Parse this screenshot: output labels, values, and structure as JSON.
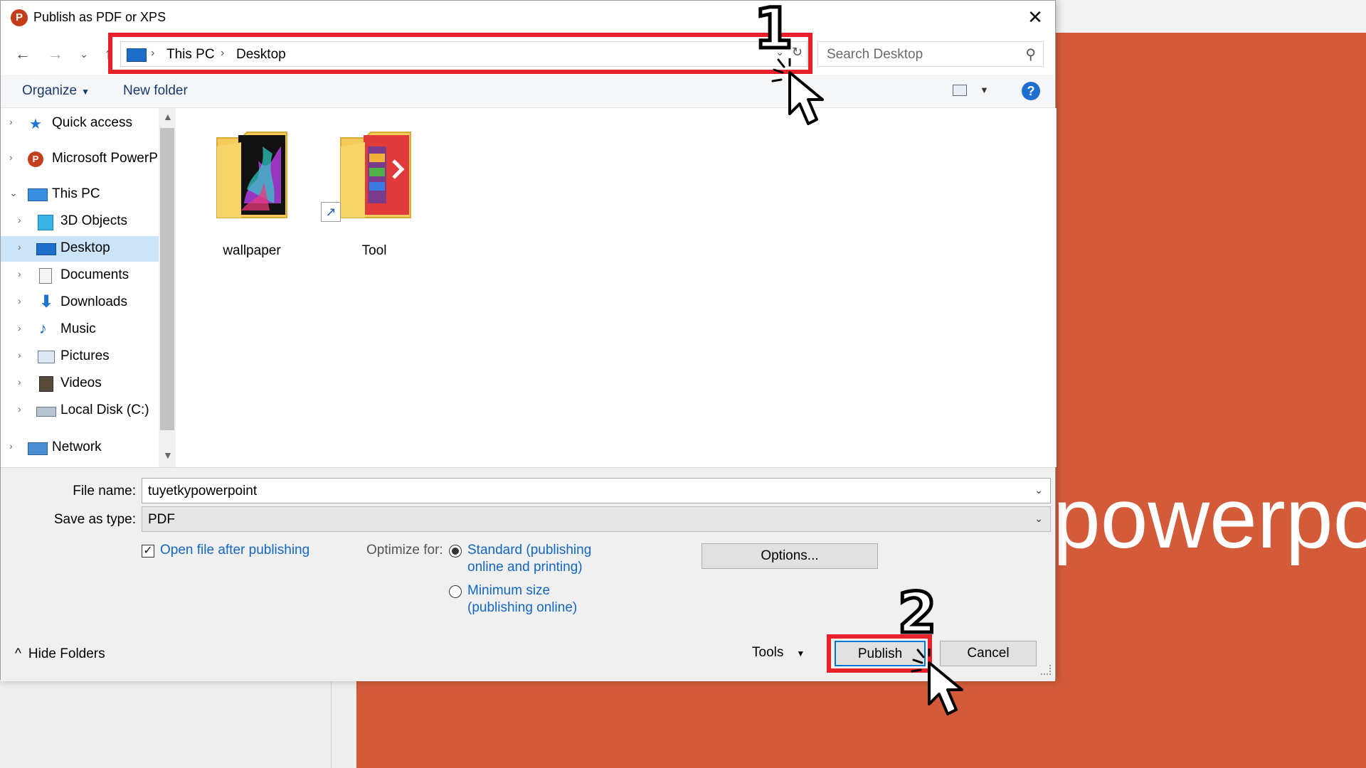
{
  "window": {
    "title": "Publish as PDF or XPS",
    "close_glyph": "✕",
    "app_icon_letter": "P"
  },
  "nav": {
    "back": "←",
    "forward": "→",
    "recent": "⌄",
    "up": "↑"
  },
  "address": {
    "segments": [
      "This PC",
      "Desktop"
    ],
    "separator": "›"
  },
  "search": {
    "placeholder": "Search Desktop"
  },
  "toolbar": {
    "organize": "Organize",
    "new_folder": "New folder",
    "help": "?"
  },
  "tree": {
    "items": [
      {
        "label": "Quick access",
        "icon": "star-icon"
      },
      {
        "label": "Microsoft PowerP",
        "icon": "powerpoint-icon"
      },
      {
        "label": "This PC",
        "icon": "computer-icon"
      },
      {
        "label": "3D Objects",
        "icon": "cube-icon"
      },
      {
        "label": "Desktop",
        "icon": "desktop-icon",
        "selected": true
      },
      {
        "label": "Documents",
        "icon": "document-icon"
      },
      {
        "label": "Downloads",
        "icon": "download-icon"
      },
      {
        "label": "Music",
        "icon": "music-icon"
      },
      {
        "label": "Pictures",
        "icon": "picture-icon"
      },
      {
        "label": "Videos",
        "icon": "video-icon"
      },
      {
        "label": "Local Disk (C:)",
        "icon": "disk-icon"
      },
      {
        "label": "Network",
        "icon": "network-icon"
      }
    ]
  },
  "files": [
    {
      "name": "wallpaper",
      "icon": "folder-icon"
    },
    {
      "name": "Tool",
      "icon": "shortcut-icon"
    }
  ],
  "form": {
    "file_name_label": "File name:",
    "file_name_value": "tuyetkypowerpoint",
    "save_type_label": "Save as type:",
    "save_type_value": "PDF",
    "open_after_label": "Open file after publishing",
    "open_after_checked": true,
    "optimize_label": "Optimize for:",
    "standard_line1": "Standard (publishing",
    "standard_line2": "online and printing)",
    "minimum_line1": "Minimum size",
    "minimum_line2": "(publishing online)",
    "options_button": "Options..."
  },
  "footer": {
    "hide_folders": "Hide Folders",
    "tools": "Tools",
    "publish": "Publish",
    "cancel": "Cancel"
  },
  "annotations": {
    "step1": "1",
    "step2": "2",
    "highlight_color": "#e8202a"
  },
  "background": {
    "slide_text": "powerpo",
    "slide_color": "#d35b3a"
  },
  "colors": {
    "link": "#1266c4",
    "selected": "#cce4f7",
    "accent": "#0078d7"
  }
}
